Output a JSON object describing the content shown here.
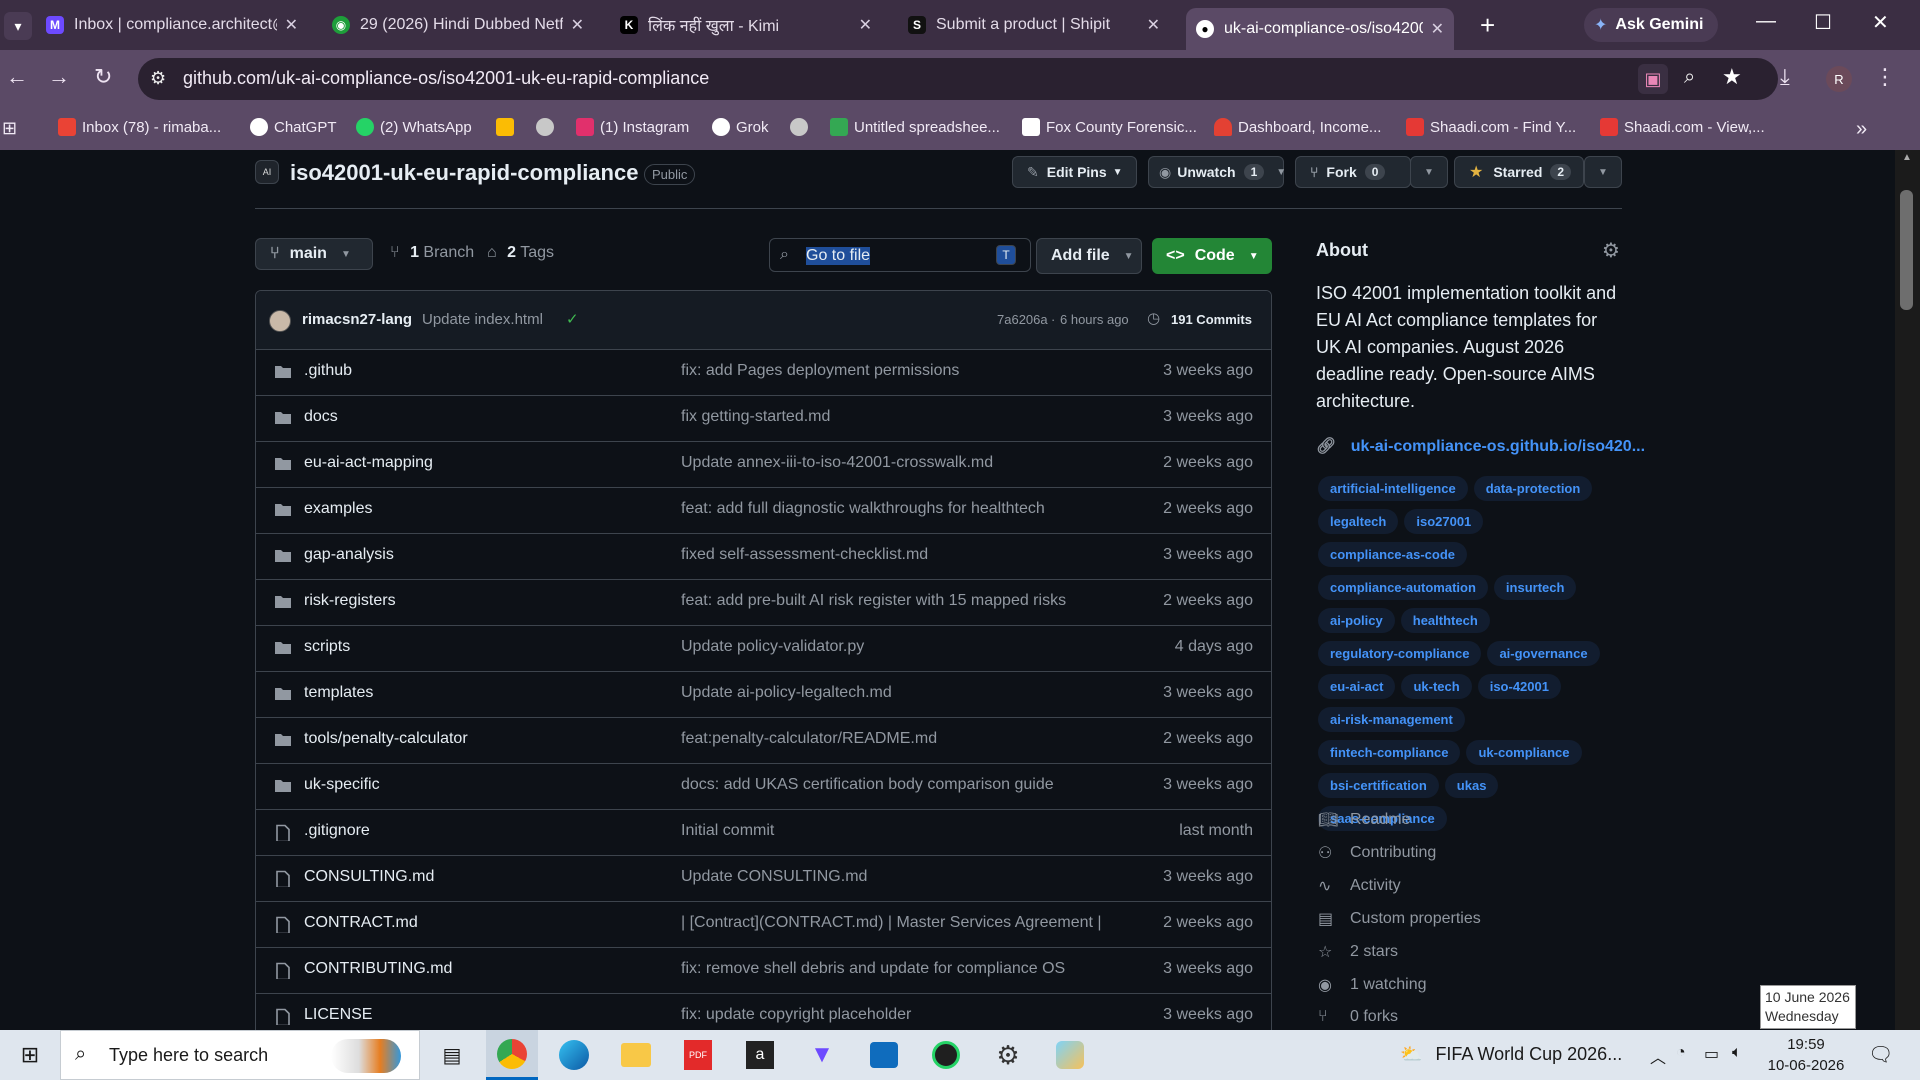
{
  "browser": {
    "tabs": [
      {
        "title": "Inbox | compliance.architect@",
        "favicon": "proton-mail-icon"
      },
      {
        "title": "29 (2026) Hindi Dubbed Netfli",
        "favicon": "globe-icon"
      },
      {
        "title": "लिंक नहीं खुला - Kimi",
        "favicon": "kimi-icon"
      },
      {
        "title": "Submit a product | Shipit",
        "favicon": "shipit-icon"
      },
      {
        "title": "uk-ai-compliance-os/iso4200",
        "favicon": "github-icon"
      }
    ],
    "new_tab": "+",
    "gemini": "Ask Gemini",
    "url": "github.com/uk-ai-compliance-os/iso42001-uk-eu-rapid-compliance",
    "profile_initial": "R",
    "bookmarks": [
      {
        "label": "Inbox (78) - rimaba...",
        "color": "#ea4335"
      },
      {
        "label": "ChatGPT",
        "color": "#ffffff"
      },
      {
        "label": "(2) WhatsApp",
        "color": "#25d366"
      },
      {
        "label": "",
        "color": "#fbbc04"
      },
      {
        "label": "",
        "color": "#c8c8c8"
      },
      {
        "label": "(1) Instagram",
        "color": "#e1306c"
      },
      {
        "label": "Grok",
        "color": "#ffffff"
      },
      {
        "label": "",
        "color": "#c8c8c8"
      },
      {
        "label": "Untitled spreadshee...",
        "color": "#34a853"
      },
      {
        "label": "Fox County Forensic...",
        "color": "#ffffff"
      },
      {
        "label": "Dashboard, Income...",
        "color": "#e34133"
      },
      {
        "label": "Shaadi.com - Find Y...",
        "color": "#e53935"
      },
      {
        "label": "Shaadi.com - View,...",
        "color": "#e53935"
      }
    ]
  },
  "repo": {
    "avatar_text": "AI",
    "name": "iso42001-uk-eu-rapid-compliance",
    "visibility": "Public",
    "edit_pins": "Edit Pins",
    "unwatch": "Unwatch",
    "watch_count": "1",
    "fork": "Fork",
    "fork_count": "0",
    "starred": "Starred",
    "star_count": "2",
    "branch": "main",
    "branches": "1",
    "branches_label": "Branch",
    "tags": "2",
    "tags_label": "Tags",
    "go_to_file": "Go to file",
    "go_to_file_key": "T",
    "add_file": "Add file",
    "code": "Code"
  },
  "commit": {
    "author": "rimacsn27-lang",
    "message": "Update index.html",
    "hash": "7a6206a",
    "time": "6 hours ago",
    "commits": "191 Commits"
  },
  "files": [
    {
      "name": ".github",
      "type": "dir",
      "message": "fix: add Pages deployment permissions",
      "date": "3 weeks ago"
    },
    {
      "name": "docs",
      "type": "dir",
      "message": "fix getting-started.md",
      "date": "3 weeks ago"
    },
    {
      "name": "eu-ai-act-mapping",
      "type": "dir",
      "message": "Update annex-iii-to-iso-42001-crosswalk.md",
      "date": "2 weeks ago"
    },
    {
      "name": "examples",
      "type": "dir",
      "message": "feat: add full diagnostic walkthroughs for healthtech",
      "date": "2 weeks ago"
    },
    {
      "name": "gap-analysis",
      "type": "dir",
      "message": "fixed self-assessment-checklist.md",
      "date": "3 weeks ago"
    },
    {
      "name": "risk-registers",
      "type": "dir",
      "message": "feat: add pre-built AI risk register with 15 mapped risks",
      "date": "2 weeks ago"
    },
    {
      "name": "scripts",
      "type": "dir",
      "message": "Update policy-validator.py",
      "date": "4 days ago"
    },
    {
      "name": "templates",
      "type": "dir",
      "message": "Update ai-policy-legaltech.md",
      "date": "3 weeks ago"
    },
    {
      "name": "tools/penalty-calculator",
      "type": "dir",
      "message": "feat:penalty-calculator/README.md",
      "date": "2 weeks ago"
    },
    {
      "name": "uk-specific",
      "type": "dir",
      "message": "docs: add UKAS certification body comparison guide",
      "date": "3 weeks ago"
    },
    {
      "name": ".gitignore",
      "type": "file",
      "message": "Initial commit",
      "date": "last month"
    },
    {
      "name": "CONSULTING.md",
      "type": "file",
      "message": "Update CONSULTING.md",
      "date": "3 weeks ago"
    },
    {
      "name": "CONTRACT.md",
      "type": "file",
      "message": "| [Contract](CONTRACT.md) | Master Services Agreement |",
      "date": "2 weeks ago"
    },
    {
      "name": "CONTRIBUTING.md",
      "type": "file",
      "message": "fix: remove shell debris and update for compliance OS",
      "date": "3 weeks ago"
    },
    {
      "name": "LICENSE",
      "type": "file",
      "message": "fix: update copyright placeholder",
      "date": "3 weeks ago"
    }
  ],
  "about": {
    "heading": "About",
    "description": "ISO 42001 implementation toolkit and EU AI Act compliance templates for UK AI companies. August 2026 deadline ready. Open-source AIMS architecture.",
    "website": "uk-ai-compliance-os.github.io/iso420...",
    "topics": [
      "artificial-intelligence",
      "data-protection",
      "legaltech",
      "iso27001",
      "compliance-as-code",
      "compliance-automation",
      "insurtech",
      "ai-policy",
      "healthtech",
      "regulatory-compliance",
      "ai-governance",
      "eu-ai-act",
      "uk-tech",
      "iso-42001",
      "ai-risk-management",
      "fintech-compliance",
      "uk-compliance",
      "bsi-certification",
      "ukas",
      "saas-compliance"
    ],
    "links": [
      {
        "label": "Readme",
        "icon": "book-icon"
      },
      {
        "label": "Contributing",
        "icon": "people-icon"
      },
      {
        "label": "Activity",
        "icon": "pulse-icon"
      },
      {
        "label": "Custom properties",
        "icon": "note-icon"
      },
      {
        "label": "2 stars",
        "icon": "star-icon"
      },
      {
        "label": "1 watching",
        "icon": "eye-icon"
      },
      {
        "label": "0 forks",
        "icon": "fork-icon"
      }
    ]
  },
  "taskbar": {
    "search_placeholder": "Type here to search",
    "weather_text": "FIFA World Cup 2026...",
    "time": "19:59",
    "date": "10-06-2026",
    "tooltip_date": "10 June 2026",
    "tooltip_day": "Wednesday"
  }
}
